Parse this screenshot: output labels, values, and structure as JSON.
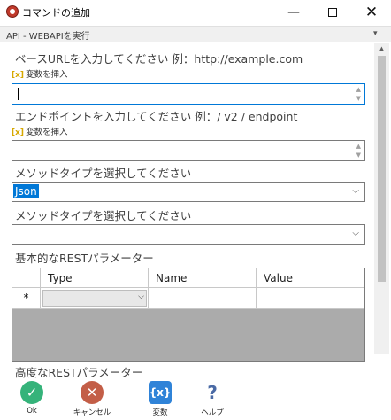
{
  "window": {
    "title": "コマンドの追加",
    "minimize_glyph": "—",
    "close_glyph": "✕"
  },
  "section": {
    "title": "API - WEBAPIを実行",
    "chevron": "▾"
  },
  "form": {
    "base_url": {
      "label": "ベースURLを入力してください 例：http://example.com",
      "insert_variable": "変数を挿入",
      "value": ""
    },
    "endpoint": {
      "label": "エンドポイントを入力してください 例：/ v2 / endpoint",
      "insert_variable": "変数を挿入",
      "value": ""
    },
    "method_type": {
      "label": "メソッドタイプを選択してください",
      "selected": "Json"
    },
    "method_type_2": {
      "label": "メソッドタイプを選択してください",
      "selected": ""
    },
    "basic_params": {
      "label": "基本的なRESTパラメーター",
      "columns": [
        "Type",
        "Name",
        "Value"
      ],
      "new_row_marker": "*"
    },
    "advanced_params": {
      "label": "高度なRESTパラメーター"
    }
  },
  "icons": {
    "insert_variable": "variable-icon",
    "spin_up": "▲",
    "spin_down": "▼",
    "combo_chevron": "⌵",
    "scroll_up": "▲"
  },
  "toolbar": {
    "ok_label": "Ok",
    "cancel_label": "キャンセル",
    "variables_label": "変数",
    "help_label": "ヘルプ",
    "ok_glyph": "✓",
    "cancel_glyph": "✕",
    "variables_glyph": "{x}",
    "help_glyph": "?"
  },
  "colors": {
    "accent": "#0078d7",
    "ok": "#35b37a",
    "cancel": "#c35e47",
    "variables": "#2f83d8",
    "insert_variable_icon": "#d7a800"
  }
}
